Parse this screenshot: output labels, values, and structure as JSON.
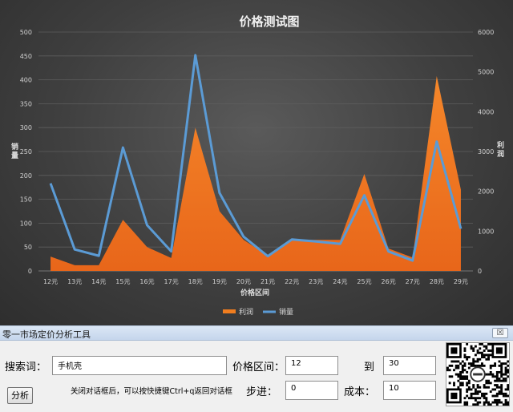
{
  "chart_data": {
    "type": "area+line",
    "title": "价格测试图",
    "xlabel": "价格区间",
    "ylabel_left": "销量",
    "ylabel_right": "利润",
    "categories": [
      "12元",
      "13元",
      "14元",
      "15元",
      "16元",
      "17元",
      "18元",
      "19元",
      "20元",
      "21元",
      "22元",
      "23元",
      "24元",
      "25元",
      "26元",
      "27元",
      "28元",
      "29元"
    ],
    "ylim_left": [
      0,
      500
    ],
    "ylim_right": [
      0,
      6000
    ],
    "yticks_left": [
      "0",
      "50",
      "100",
      "150",
      "200",
      "250",
      "300",
      "350",
      "400",
      "450",
      "500"
    ],
    "yticks_right": [
      "0",
      "1000",
      "2000",
      "3000",
      "4000",
      "5000",
      "6000"
    ],
    "grid": true,
    "legend_position": "bottom",
    "series": [
      {
        "name": "利润",
        "kind": "area",
        "axis": "left",
        "color": "#f07d1f",
        "values": [
          30,
          12,
          12,
          107,
          50,
          27,
          300,
          125,
          65,
          32,
          65,
          65,
          65,
          203,
          47,
          28,
          408,
          170
        ]
      },
      {
        "name": "销量",
        "kind": "line",
        "axis": "right",
        "color": "#5b9bd5",
        "values": [
          2200,
          540,
          380,
          3100,
          1150,
          490,
          5420,
          1960,
          860,
          370,
          790,
          740,
          680,
          1900,
          490,
          260,
          3250,
          1060
        ]
      }
    ]
  },
  "dialog": {
    "title": "零一市场定价分析工具",
    "close_label": "☒",
    "search_label": "搜索词：",
    "search_value": "手机壳",
    "price_range_label": "价格区间：",
    "price_from": "12",
    "to_label": "到",
    "price_to": "30",
    "step_label": "步进：",
    "step_value": "0",
    "cost_label": "成本：",
    "cost_value": "10",
    "analyze_label": "分析",
    "hint": "关闭对话框后，可以按快捷键Ctrl+q返回对话框"
  }
}
